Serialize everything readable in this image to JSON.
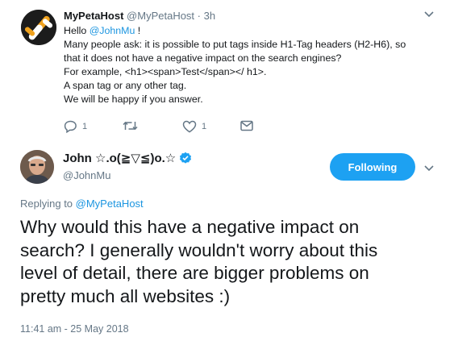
{
  "tweet1": {
    "display_name": "MyPetaHost",
    "handle": "@MyPetaHost",
    "separator": "·",
    "time": "3h",
    "lines": [
      {
        "pre": "Hello ",
        "link": "@JohnMu",
        "post": " !"
      },
      {
        "pre": "Many people ask: it is possible to put tags inside H1-Tag headers (H2-H6), so",
        "link": "",
        "post": ""
      },
      {
        "pre": "that it does not have a negative impact on the search engines?",
        "link": "",
        "post": ""
      },
      {
        "pre": "For example, <h1><span>Test</span></ h1>.",
        "link": "",
        "post": ""
      },
      {
        "pre": "A span tag or any other tag.",
        "link": "",
        "post": ""
      },
      {
        "pre": "We will be happy if you answer.",
        "link": "",
        "post": ""
      }
    ],
    "reply_count": "1",
    "retweet_count": "",
    "like_count": "1",
    "icons": {
      "reply": "reply-icon",
      "retweet": "retweet-icon",
      "like": "heart-icon",
      "dm": "envelope-icon",
      "menu": "chevron-down-icon"
    }
  },
  "tweet2": {
    "display_name": "John ☆.o(≧▽≦)o.☆",
    "handle": "@JohnMu",
    "follow_label": "Following",
    "replying_prefix": "Replying to ",
    "replying_to": "@MyPetaHost",
    "text_lines": [
      "Why would this have a negative impact on",
      "search? I generally wouldn't worry about this",
      "level of detail, there are bigger problems on",
      "pretty much all websites :)"
    ],
    "timestamp": "11:41 am - 25 May 2018",
    "icons": {
      "verified": "verified-badge-icon",
      "menu": "chevron-down-icon"
    }
  },
  "colors": {
    "accent": "#1da1f2",
    "link": "#1b95e0",
    "muted": "#657786",
    "text": "#14171a"
  }
}
